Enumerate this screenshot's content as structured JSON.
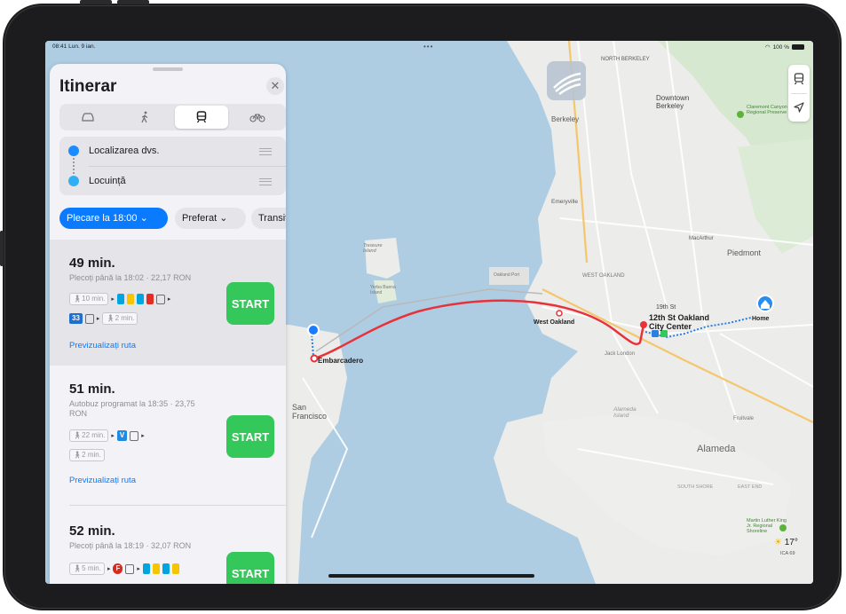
{
  "status_bar": {
    "time": "08:41",
    "date": "Lun. 9 ian.",
    "battery": "100 %"
  },
  "panel": {
    "title": "Itinerar",
    "modes": [
      "car",
      "walk",
      "transit",
      "bike"
    ],
    "active_mode": "transit",
    "origin": "Localizarea dvs.",
    "destination": "Locuință",
    "filters": {
      "departure": "Plecare la 18:00",
      "preferred": "Preferat",
      "transit": "Transit"
    },
    "routes": [
      {
        "time": "49 min.",
        "subtitle": "Plecoți până la 18:02 · 22,17 RON",
        "walk1": "10 min.",
        "line_badge": "33",
        "walk2": "2 min.",
        "start": "START",
        "preview": "Previzualizați ruta"
      },
      {
        "time": "51 min.",
        "subtitle": "Autobuz programat la 18:35 · 23,75 RON",
        "walk1": "22 min.",
        "line_badge": "V",
        "walk2": "2 min.",
        "start": "START",
        "preview": "Previzualizați ruta"
      },
      {
        "time": "52 min.",
        "subtitle": "Plecoți până la 18:19 · 32,07 RON",
        "walk1": "5 min.",
        "line_badge": "F",
        "start": "START"
      }
    ]
  },
  "map": {
    "labels": {
      "north_berkeley": "NORTH BERKELEY",
      "downtown_berkeley": "Downtown Berkeley",
      "berkeley": "Berkeley",
      "claremont": "Claremont Canyon Regional Preserve",
      "emeryville": "Emeryville",
      "piedmont": "Piedmont",
      "treasure_island": "Treasure Island",
      "yerba_buena": "Yerba Buena Island",
      "west_oakland_area": "WEST OAKLAND",
      "west_oakland_station": "West Oakland",
      "oakland_stop": "12th St Oakland City Center",
      "station_19th": "19th St",
      "home": "Home",
      "embarcadero": "Embarcadero",
      "san_francisco": "San Francisco",
      "alameda_island": "Alameda Island",
      "alameda": "Alameda",
      "mac_arthur": "MacArthur",
      "fruitvale": "Fruitvale",
      "oakland_port": "Oakland Port",
      "jack_london": "Jack London",
      "east_end": "EAST END",
      "south_shore": "SOUTH SHORE",
      "mlk_shoreline": "Martin Luther King Jr. Regional Shoreline"
    },
    "weather": {
      "temp": "17°",
      "aqi": "ICA 69"
    },
    "colors": {
      "route": "#e8323b",
      "walk": "#2b7fe0",
      "start_pin": "#1a7bff"
    }
  }
}
